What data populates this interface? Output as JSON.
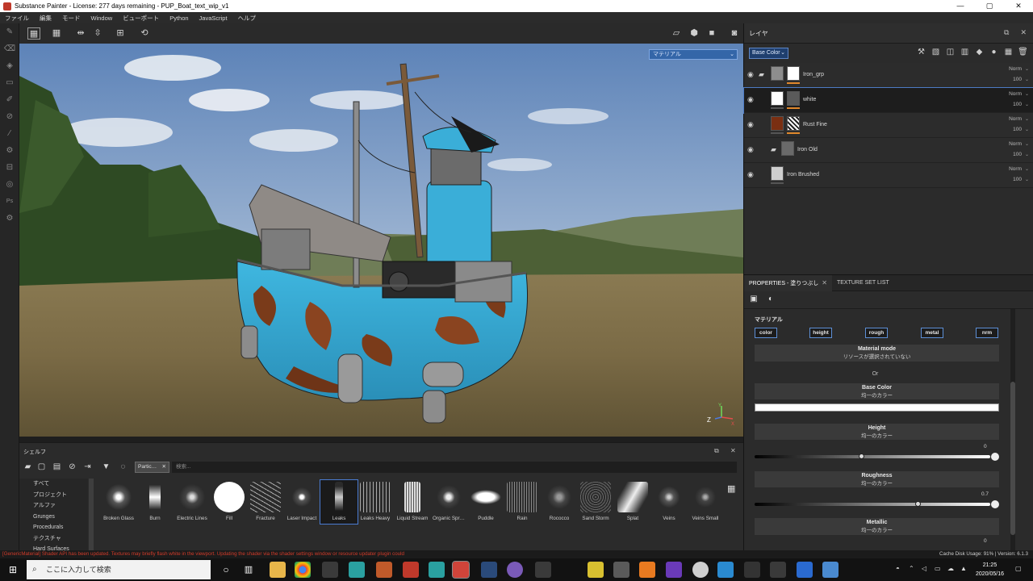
{
  "window": {
    "title": "Substance Painter - License: 277 days remaining - PUP_Boat_text_wip_v1",
    "controls": [
      "—",
      "▢",
      "✕"
    ]
  },
  "menu": [
    "ファイル",
    "編集",
    "モード",
    "Window",
    "ビューポート",
    "Python",
    "JavaScript",
    "ヘルプ"
  ],
  "viewport": {
    "material_dropdown": "マテリアル",
    "axis_labels": {
      "z": "Z",
      "x": "X",
      "y": "Y"
    }
  },
  "layers": {
    "title": "レイヤ",
    "channel": "Base Color",
    "rows": [
      {
        "name": "Iron_grp",
        "blend": "Norm",
        "opacity": "100",
        "type": "folder"
      },
      {
        "name": "white",
        "blend": "Norm",
        "opacity": "100",
        "type": "fill"
      },
      {
        "name": "Rust Fine",
        "blend": "Norm",
        "opacity": "100",
        "type": "fill"
      },
      {
        "name": "Iron Old",
        "blend": "Norm",
        "opacity": "100",
        "type": "folder"
      },
      {
        "name": "Iron Brushed",
        "blend": "Norm",
        "opacity": "100",
        "type": "fill"
      }
    ]
  },
  "properties": {
    "tab_properties": "PROPERTIES - 塗りつぶし",
    "tab_texture_set": "TEXTURE SET LIST",
    "section_material": "マテリアル",
    "channel_buttons": [
      "color",
      "height",
      "rough",
      "metal",
      "nrm"
    ],
    "material_mode": {
      "title": "Material mode",
      "value": "リソースが選択されていない"
    },
    "or_label": "Or",
    "base_color": {
      "title": "Base Color",
      "sub": "均一のカラー"
    },
    "height": {
      "title": "Height",
      "sub": "均一のカラー",
      "value": "0"
    },
    "roughness": {
      "title": "Roughness",
      "sub": "均一のカラー",
      "value": "0.7"
    },
    "metallic": {
      "title": "Metallic",
      "sub": "均一のカラー",
      "value": "0"
    }
  },
  "shelf": {
    "title": "シェルフ",
    "filter_chip": "Partic…",
    "search_placeholder": "検索...",
    "categories": [
      "すべて",
      "プロジェクト",
      "アルファ",
      "Grunges",
      "Procedurals",
      "テクスチャ",
      "Hard Surfaces"
    ],
    "items": [
      "Broken Glass",
      "Burn",
      "Electric Lines",
      "Fill",
      "Fracture",
      "Laser Impact",
      "Leaks",
      "Leaks Heavy",
      "Liquid Stream",
      "Organic Spr…",
      "Puddle",
      "Rain",
      "Rococco",
      "Sand Storm",
      "Splat",
      "Veins",
      "Veins Small"
    ],
    "selected": "Leaks"
  },
  "status": {
    "message": "[GenericMaterial] Shader API has been updated. Textures may briefly flash white in the viewport. Updating the shader via the shader settings window or resource updater plugin could",
    "cache": "Cache Disk Usage:  91% | Version: 6.1.3"
  },
  "taskbar": {
    "search_placeholder": "ここに入力して検索",
    "time": "21:25",
    "date": "2020/05/16"
  },
  "colors": {
    "accent_blue": "#4d7bc4",
    "orange_mask": "#e0882c",
    "status_error": "#d23b2a"
  }
}
